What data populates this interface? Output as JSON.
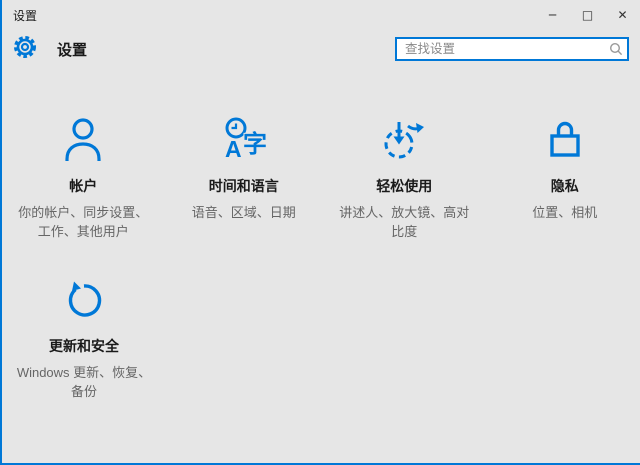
{
  "colors": {
    "accent": "#0078d7",
    "window_background": "#e6e6e6",
    "title_text": "#1a1a1a",
    "description_text": "#666666",
    "search_field_background": "#ffffff"
  },
  "titlebar": {
    "title": "设置",
    "minimize_glyph": "─",
    "maximize_glyph": "□",
    "close_glyph": "✕"
  },
  "header": {
    "app_title": "设置",
    "icon": "gear-icon"
  },
  "search": {
    "placeholder": "查找设置",
    "icon": "search-icon"
  },
  "tiles": [
    {
      "icon": "person-icon",
      "title": "帐户",
      "description": "你的帐户、同步设置、工作、其他用户"
    },
    {
      "icon": "clock-language-icon",
      "title": "时间和语言",
      "description": "语音、区域、日期"
    },
    {
      "icon": "ease-of-access-icon",
      "title": "轻松使用",
      "description": "讲述人、放大镜、高对比度"
    },
    {
      "icon": "lock-icon",
      "title": "隐私",
      "description": "位置、相机"
    },
    {
      "icon": "refresh-icon",
      "title": "更新和安全",
      "description": "Windows 更新、恢复、备份"
    }
  ]
}
